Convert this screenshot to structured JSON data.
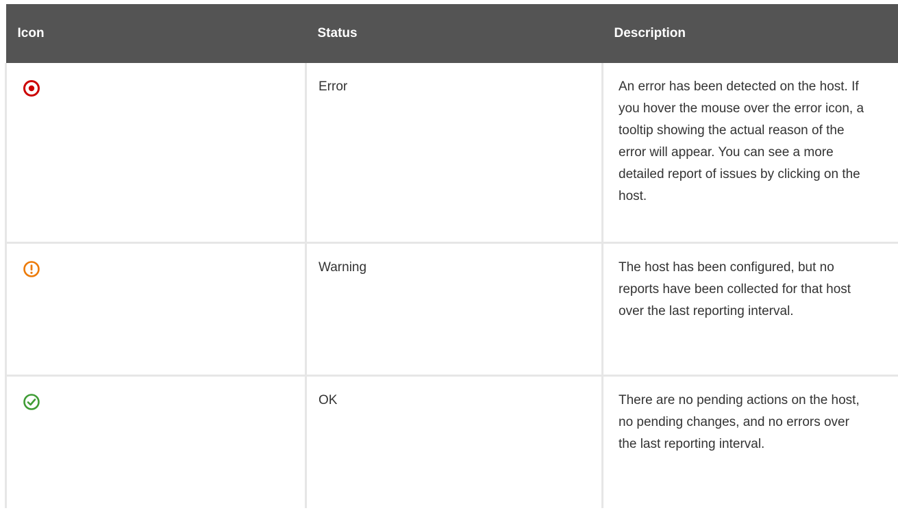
{
  "table": {
    "headers": {
      "icon": "Icon",
      "status": "Status",
      "description": "Description"
    },
    "rows": [
      {
        "icon": "error-icon",
        "icon_color": "#cc0000",
        "status": "Error",
        "description": "An error has been detected on the host. If you hover the mouse over the error icon, a tooltip showing the actual reason of the error will appear. You can see a more detailed report of issues by clicking on the host."
      },
      {
        "icon": "warning-icon",
        "icon_color": "#ec7a08",
        "status": "Warning",
        "description": "The host has been configured, but no reports have been collected for that host over the last reporting interval."
      },
      {
        "icon": "ok-icon",
        "icon_color": "#3f9c35",
        "status": "OK",
        "description": "There are no pending actions on the host, no pending changes, and no errors over the last reporting interval."
      }
    ]
  },
  "colors": {
    "header_background": "#545454",
    "header_text": "#ffffff",
    "border": "#e6e6e6",
    "body_text": "#333333"
  }
}
